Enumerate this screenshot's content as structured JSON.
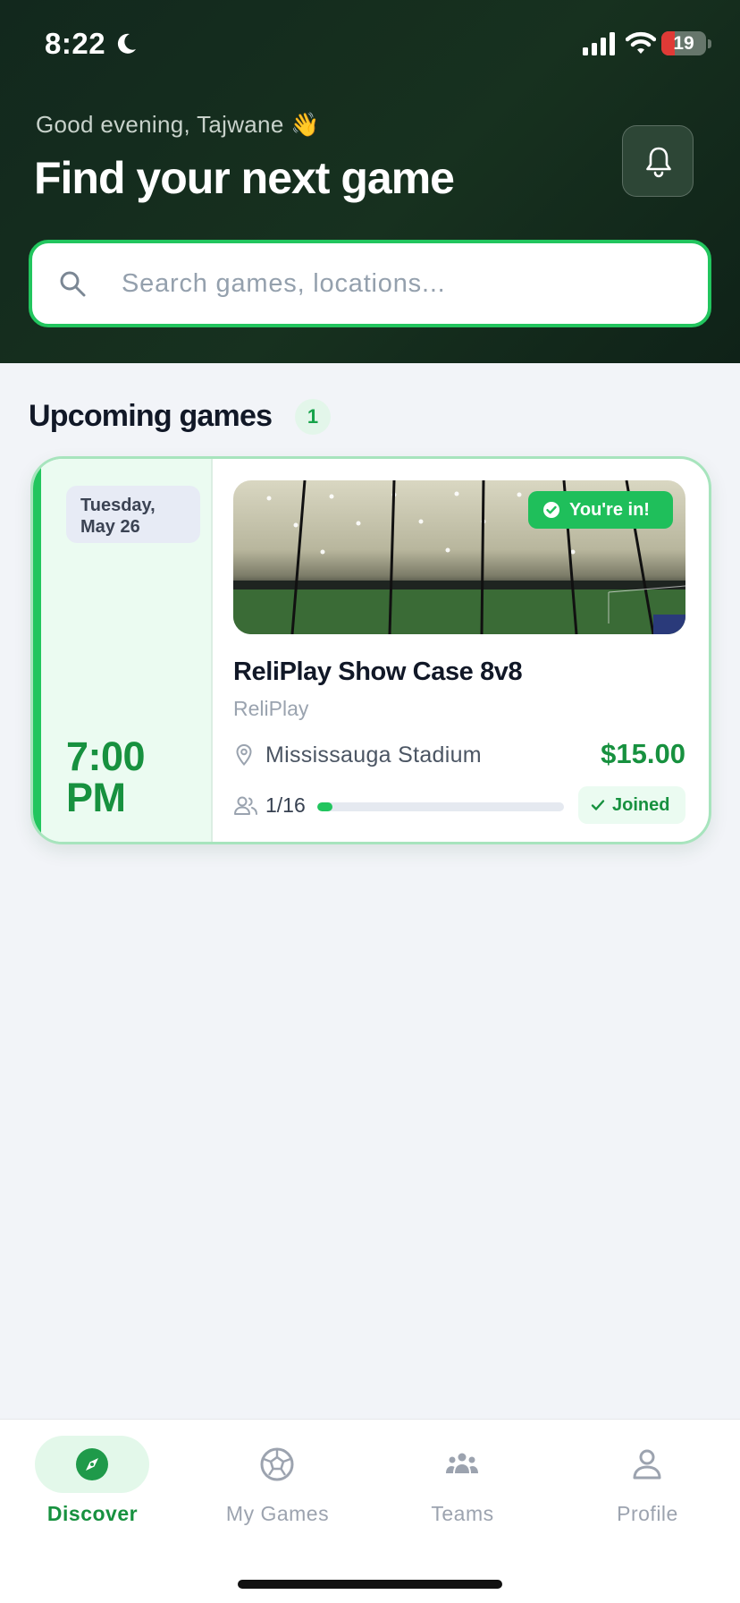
{
  "status_bar": {
    "time": "8:22",
    "battery": "19",
    "battery_level": 0.19
  },
  "header": {
    "greeting": "Good evening, Tajwane 👋",
    "title": "Find your next game"
  },
  "search": {
    "placeholder": "Search games, locations...",
    "value": ""
  },
  "upcoming": {
    "title": "Upcoming games",
    "count": "1",
    "games": [
      {
        "day": "Tuesday,",
        "date": "May 26",
        "time": "7:00",
        "meridiem": "PM",
        "status_badge": "You're in!",
        "title": "ReliPlay Show Case 8v8",
        "organizer": "ReliPlay",
        "location": "Mississauga Stadium",
        "price": "$15.00",
        "players": "1/16",
        "players_filled": 1,
        "players_capacity": 16,
        "joined_label": "Joined"
      }
    ]
  },
  "tabs": [
    {
      "label": "Discover",
      "icon": "compass-icon",
      "active": true
    },
    {
      "label": "My Games",
      "icon": "soccer-ball-icon",
      "active": false
    },
    {
      "label": "Teams",
      "icon": "people-group-icon",
      "active": false
    },
    {
      "label": "Profile",
      "icon": "person-icon",
      "active": false
    }
  ],
  "colors": {
    "header_bg": "#15301f",
    "accent": "#22c55e",
    "accent_dark": "#17913f",
    "battery_low": "#e03a36"
  }
}
